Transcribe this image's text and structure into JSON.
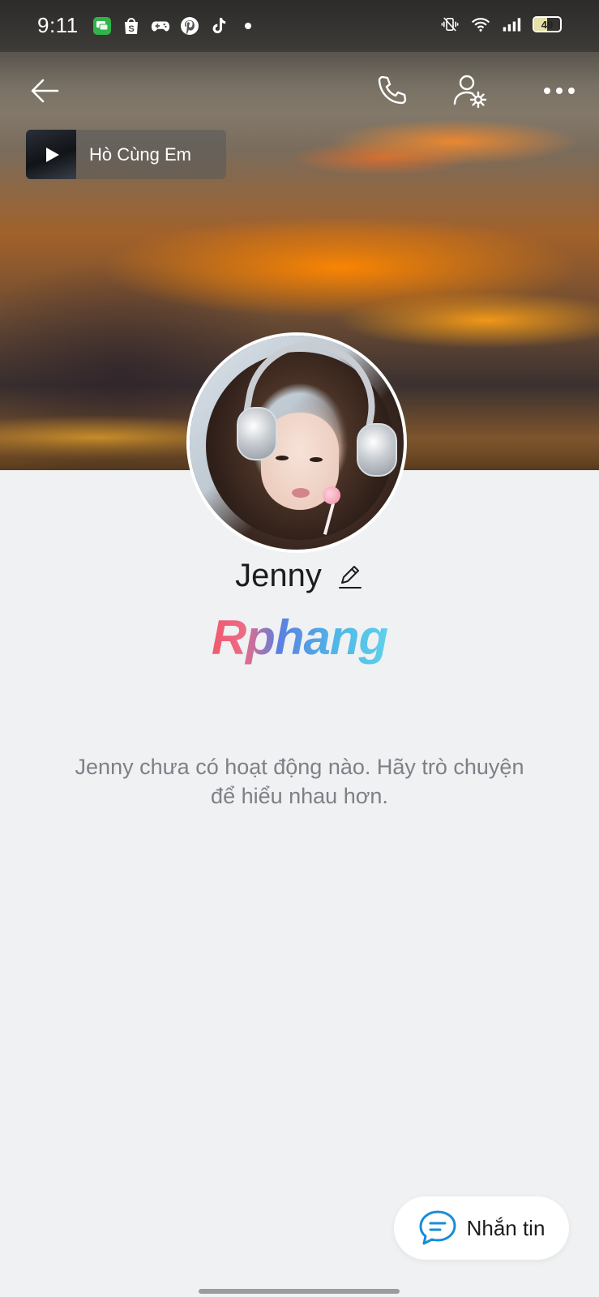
{
  "status_bar": {
    "time": "9:11",
    "battery_level": "49",
    "battery_fraction": 0.49,
    "left_icons": [
      "chat-app-icon",
      "shopping-bag-icon",
      "gamepad-icon",
      "pinterest-icon",
      "tiktok-icon",
      "dot-icon"
    ],
    "right_icons": [
      "vibrate-mute-icon",
      "wifi-icon",
      "signal-icon",
      "battery-icon"
    ]
  },
  "header": {
    "back_icon": "back-arrow-icon",
    "call_icon": "phone-icon",
    "settings_icon": "user-settings-icon",
    "more_icon": "more-dots-icon"
  },
  "music": {
    "title": "Hò Cùng Em",
    "play_icon": "play-icon"
  },
  "profile": {
    "name": "Jenny",
    "edit_icon": "pencil-icon",
    "watermark": "Rphang",
    "empty_message": "Jenny chưa có hoạt động nào. Hãy trò chuyện để hiểu nhau hơn."
  },
  "actions": {
    "message_label": "Nhắn tin",
    "message_icon": "chat-bubble-icon"
  },
  "colors": {
    "background": "#eff1f3",
    "accent_blue": "#1a8cd8",
    "text_primary": "#1c1c1e",
    "text_muted": "#7d8086"
  }
}
